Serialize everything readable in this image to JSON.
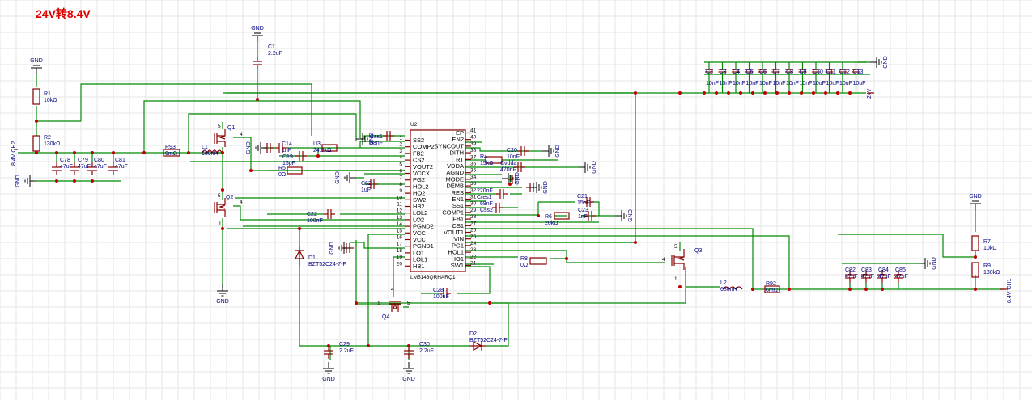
{
  "title": "24V转8.4V",
  "ic": {
    "ref": "U2",
    "part": "LM5143QRHARQ1",
    "left_pins": [
      {
        "name": "SS2",
        "num": "1"
      },
      {
        "name": "COMP2",
        "num": "2"
      },
      {
        "name": "FB2",
        "num": "3"
      },
      {
        "name": "CS2",
        "num": "4"
      },
      {
        "name": "VOUT2",
        "num": "5"
      },
      {
        "name": "VCCX",
        "num": "6"
      },
      {
        "name": "PG2",
        "num": "7"
      },
      {
        "name": "HOL2",
        "num": "8"
      },
      {
        "name": "HO2",
        "num": "9"
      },
      {
        "name": "SW2",
        "num": "10"
      },
      {
        "name": "HB2",
        "num": "11"
      },
      {
        "name": "LOL2",
        "num": "12"
      },
      {
        "name": "LO2",
        "num": "13"
      },
      {
        "name": "PGND2",
        "num": "14"
      },
      {
        "name": "VCC",
        "num": "15"
      },
      {
        "name": "VCC",
        "num": "16"
      },
      {
        "name": "PGND1",
        "num": "17"
      },
      {
        "name": "LO1",
        "num": "18"
      },
      {
        "name": "LOL1",
        "num": "19"
      },
      {
        "name": "HB1",
        "num": "20"
      }
    ],
    "right_pins": [
      {
        "name": "EP",
        "num": "41"
      },
      {
        "name": "EN2",
        "num": "40"
      },
      {
        "name": "SYNCOUT",
        "num": "39"
      },
      {
        "name": "DITH",
        "num": "38"
      },
      {
        "name": "RT",
        "num": "37"
      },
      {
        "name": "VDDA",
        "num": "36"
      },
      {
        "name": "AGND",
        "num": "35"
      },
      {
        "name": "MODE",
        "num": "34"
      },
      {
        "name": "DEMB",
        "num": "33"
      },
      {
        "name": "RES",
        "num": "32"
      },
      {
        "name": "EN1",
        "num": "31"
      },
      {
        "name": "SS1",
        "num": "30"
      },
      {
        "name": "COMP1",
        "num": "29"
      },
      {
        "name": "FB1",
        "num": "28"
      },
      {
        "name": "CS1",
        "num": "27"
      },
      {
        "name": "VOUT1",
        "num": "26"
      },
      {
        "name": "VIN",
        "num": "25"
      },
      {
        "name": "PG1",
        "num": "24"
      },
      {
        "name": "HOL1",
        "num": "23"
      },
      {
        "name": "HO1",
        "num": "22"
      },
      {
        "name": "SW1",
        "num": "21"
      }
    ]
  },
  "labels": [
    {
      "id": "C1",
      "lines": [
        "C1",
        "2.2uF"
      ]
    },
    {
      "id": "R1",
      "lines": [
        "R1",
        "10kΩ"
      ]
    },
    {
      "id": "R2",
      "lines": [
        "R2",
        "130kΩ"
      ]
    },
    {
      "id": "Q1",
      "lines": [
        "Q1"
      ]
    },
    {
      "id": "Q2",
      "lines": [
        "Q2"
      ]
    },
    {
      "id": "Q3",
      "lines": [
        "Q3"
      ]
    },
    {
      "id": "Q4",
      "lines": [
        "Q4"
      ]
    },
    {
      "id": "R93",
      "lines": [
        "R93",
        "6mΩ"
      ]
    },
    {
      "id": "L1",
      "lines": [
        "L1",
        "680nH"
      ]
    },
    {
      "id": "C14",
      "lines": [
        "C14",
        "1nF"
      ]
    },
    {
      "id": "C19",
      "lines": [
        "C19",
        "15pF"
      ]
    },
    {
      "id": "U3",
      "lines": [
        "U3",
        "24.9kΩ"
      ]
    },
    {
      "id": "R5",
      "lines": [
        "R5",
        "0Ω"
      ]
    },
    {
      "id": "Css1",
      "lines": [
        "Css1",
        "68nF"
      ]
    },
    {
      "id": "C62",
      "lines": [
        "C62",
        "1uF"
      ]
    },
    {
      "id": "C22",
      "lines": [
        "C22",
        "100nF"
      ]
    },
    {
      "id": "R4",
      "lines": [
        "R4",
        "15kΩ"
      ]
    },
    {
      "id": "C20",
      "lines": [
        "C20",
        "10nF"
      ]
    },
    {
      "id": "Cvdda",
      "lines": [
        "Cvdda",
        "470nF"
      ]
    },
    {
      "id": "Cres1",
      "lines": [
        "220nF",
        "Cres1"
      ]
    },
    {
      "id": "Css2",
      "lines": [
        "68nF",
        "Css2"
      ]
    },
    {
      "id": "C21",
      "lines": [
        "C21",
        "15pF"
      ]
    },
    {
      "id": "R6",
      "lines": [
        "R6",
        "20kΩ"
      ]
    },
    {
      "id": "C23",
      "lines": [
        "C23",
        "1nF"
      ]
    },
    {
      "id": "R8",
      "lines": [
        "R8",
        "0Ω"
      ]
    },
    {
      "id": "C28",
      "lines": [
        "C28",
        "100nF"
      ]
    },
    {
      "id": "C29",
      "lines": [
        "C29",
        "2.2uF"
      ]
    },
    {
      "id": "C30",
      "lines": [
        "C30",
        "2.2uF"
      ]
    },
    {
      "id": "D1",
      "lines": [
        "D1",
        "BZT52C24-7-F"
      ]
    },
    {
      "id": "D2",
      "lines": [
        "D2",
        "BZT52C24-7-F"
      ]
    },
    {
      "id": "L2",
      "lines": [
        "L2",
        "680nH"
      ]
    },
    {
      "id": "R92",
      "lines": [
        "R92",
        "6mΩ"
      ]
    },
    {
      "id": "R7",
      "lines": [
        "R7",
        "10kΩ"
      ]
    },
    {
      "id": "R9",
      "lines": [
        "R9",
        "130kΩ"
      ]
    },
    {
      "id": "C78",
      "lines": [
        "C78",
        "47uF"
      ]
    },
    {
      "id": "C79",
      "lines": [
        "C79",
        "47uF"
      ]
    },
    {
      "id": "C80",
      "lines": [
        "C80",
        "47uF"
      ]
    },
    {
      "id": "C81",
      "lines": [
        "C81",
        "47uF"
      ]
    },
    {
      "id": "C82",
      "lines": [
        "C82",
        "47uF"
      ]
    },
    {
      "id": "C83",
      "lines": [
        "C83",
        "47uF"
      ]
    },
    {
      "id": "C84",
      "lines": [
        "C84",
        "47uF"
      ]
    },
    {
      "id": "C85",
      "lines": [
        "C85",
        "47uF"
      ]
    }
  ],
  "top_caps": [
    {
      "ref": "C2",
      "val": "10nF"
    },
    {
      "ref": "C3",
      "val": "10nF"
    },
    {
      "ref": "C4",
      "val": "10nF"
    },
    {
      "ref": "C5",
      "val": "10nF"
    },
    {
      "ref": "C6",
      "val": "10nF"
    },
    {
      "ref": "C7",
      "val": "10nF"
    },
    {
      "ref": "C8",
      "val": "10nF"
    },
    {
      "ref": "C9",
      "val": "10nF"
    },
    {
      "ref": "C10",
      "val": "10uF"
    },
    {
      "ref": "C11",
      "val": "10uF"
    },
    {
      "ref": "C12",
      "val": "10uF"
    },
    {
      "ref": "C13",
      "val": "10uF"
    }
  ],
  "nets": {
    "in24": "24V",
    "out1": "8.4V CH2",
    "out2": "8.4V CH1",
    "gnd": "GND"
  },
  "pin_numbers": {
    "q_gate": "4",
    "q_drain": "5",
    "q_source": "1"
  }
}
